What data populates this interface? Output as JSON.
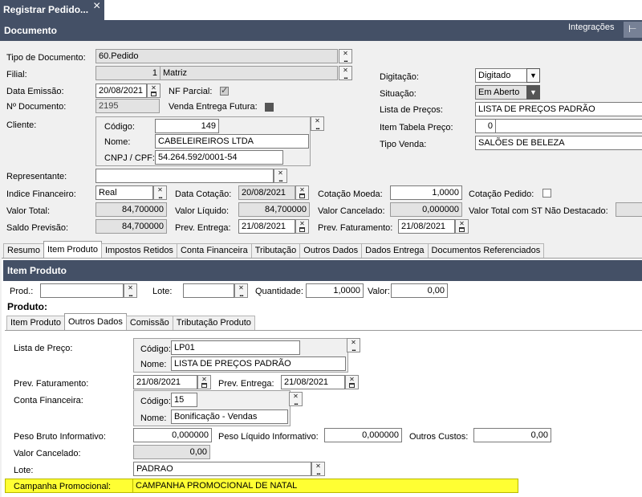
{
  "window": {
    "title": "Registrar Pedido...",
    "close": "×"
  },
  "section_header": {
    "title": "Documento",
    "integracoes": "Integrações",
    "pin": "⊢"
  },
  "doc": {
    "tipo_documento": {
      "label": "Tipo de Documento:",
      "value": "60.Pedido"
    },
    "filial": {
      "label": "Filial:",
      "code": "1",
      "name": "Matriz"
    },
    "data_emissao": {
      "label": "Data Emissão:",
      "value": "20/08/2021"
    },
    "nf_parcial": {
      "label": "NF Parcial:",
      "checked": true
    },
    "numero": {
      "label": "Nº Documento:",
      "value": "2195"
    },
    "venda_futura": {
      "label": "Venda Entrega Futura:"
    },
    "cliente": {
      "label": "Cliente:",
      "codigo_label": "Código:",
      "codigo": "149",
      "nome_label": "Nome:",
      "nome": "CABELEIREIROS LTDA",
      "cnpj_label": "CNPJ / CPF:",
      "cnpj": "54.264.592/0001-54"
    },
    "digitacao": {
      "label": "Digitação:",
      "value": "Digitado"
    },
    "situacao": {
      "label": "Situação:",
      "value": "Em Aberto"
    },
    "lista_precos": {
      "label": "Lista de Preços:",
      "value": "LISTA DE PREÇOS PADRÃO"
    },
    "item_tabela": {
      "label": "Item Tabela Preço:",
      "value": "0"
    },
    "tipo_venda": {
      "label": "Tipo Venda:",
      "value": "SALÕES DE BELEZA"
    },
    "representante": {
      "label": "Representante:",
      "value": ""
    },
    "indice": {
      "label": "Indice Financeiro:",
      "value": "Real"
    },
    "data_cotacao": {
      "label": "Data Cotação:",
      "value": "20/08/2021"
    },
    "cotacao_moeda": {
      "label": "Cotação Moeda:",
      "value": "1,0000"
    },
    "cotacao_pedido": {
      "label": "Cotação Pedido:"
    },
    "valor_total": {
      "label": "Valor Total:",
      "value": "84,700000"
    },
    "valor_liquido": {
      "label": "Valor Líquido:",
      "value": "84,700000"
    },
    "valor_cancelado": {
      "label": "Valor Cancelado:",
      "value": "0,000000"
    },
    "valor_total_st": {
      "label": "Valor Total com ST Não Destacado:"
    },
    "saldo_previsao": {
      "label": "Saldo Previsão:",
      "value": "84,700000"
    },
    "prev_entrega": {
      "label": "Prev. Entrega:",
      "value": "21/08/2021"
    },
    "prev_faturamento": {
      "label": "Prev. Faturamento:",
      "value": "21/08/2021"
    }
  },
  "main_tabs": [
    "Resumo",
    "Item Produto",
    "Impostos Retidos",
    "Conta Financeira",
    "Tributação",
    "Outros Dados",
    "Dados Entrega",
    "Documentos Referenciados"
  ],
  "item_header": "Item Produto",
  "item": {
    "prod_label": "Prod.:",
    "prod": "",
    "lote_label": "Lote:",
    "lote": "",
    "qtd_label": "Quantidade:",
    "qtd": "1,0000",
    "valor_label": "Valor:",
    "valor": "0,00",
    "produto_label": "Produto:"
  },
  "sub_tabs": [
    "Item Produto",
    "Outros Dados",
    "Comissão",
    "Tributação Produto"
  ],
  "outros": {
    "lista_preco_label": "Lista de Preço:",
    "lp_codigo_label": "Código:",
    "lp_codigo": "LP01",
    "lp_nome_label": "Nome:",
    "lp_nome": "LISTA DE PREÇOS PADRÃO",
    "prev_fat_label": "Prev. Faturamento:",
    "prev_fat": "21/08/2021",
    "prev_ent_label": "Prev. Entrega:",
    "prev_ent": "21/08/2021",
    "conta_label": "Conta Financeira:",
    "cf_codigo_label": "Código:",
    "cf_codigo": "15",
    "cf_nome_label": "Nome:",
    "cf_nome": "Bonificação - Vendas",
    "peso_bruto_label": "Peso Bruto Informativo:",
    "peso_bruto": "0,000000",
    "peso_liq_label": "Peso Líquido Informativo:",
    "peso_liq": "0,000000",
    "outros_custos_label": "Outros Custos:",
    "outros_custos": "0,00",
    "valor_cancelado_label": "Valor Cancelado:",
    "valor_cancelado": "0,00",
    "lote_label": "Lote:",
    "lote": "PADRAO",
    "campanha_label": "Campanha Promocional:",
    "campanha": "CAMPANHA PROMOCIONAL DE NATAL"
  },
  "colors": {
    "header": "#445066",
    "highlight": "#ffff33"
  }
}
